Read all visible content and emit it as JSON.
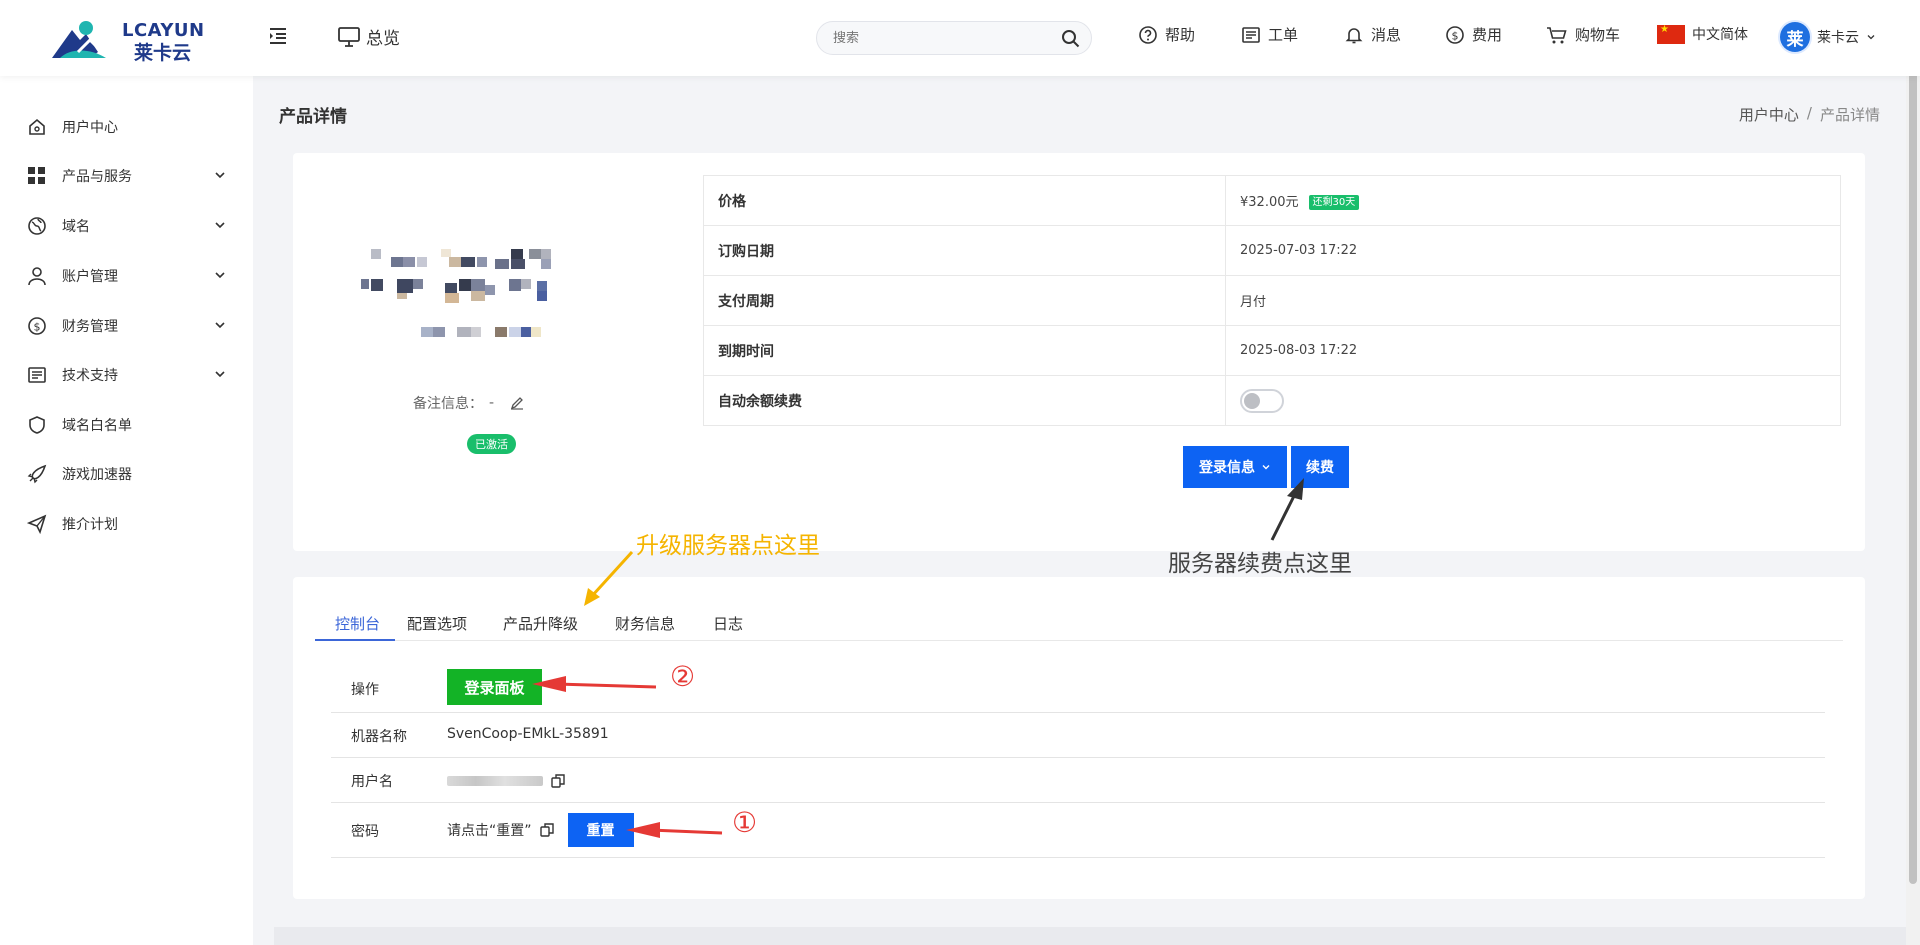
{
  "brand": {
    "logo_text_en": "LCAYUN",
    "logo_text_cn": "莱卡云"
  },
  "header": {
    "overview_label": "总览",
    "search_placeholder": "搜索",
    "help_label": "帮助",
    "ticket_label": "工单",
    "message_label": "消息",
    "fee_label": "费用",
    "cart_label": "购物车",
    "language_label": "中文简体",
    "avatar_char": "莱",
    "user_label": "莱卡云"
  },
  "sidebar": {
    "items": [
      {
        "label": "用户中心",
        "icon": "home-icon",
        "expandable": false
      },
      {
        "label": "产品与服务",
        "icon": "grid-icon",
        "expandable": true
      },
      {
        "label": "域名",
        "icon": "globe-icon",
        "expandable": true
      },
      {
        "label": "账户管理",
        "icon": "user-icon",
        "expandable": true
      },
      {
        "label": "财务管理",
        "icon": "dollar-icon",
        "expandable": true
      },
      {
        "label": "技术支持",
        "icon": "document-icon",
        "expandable": true
      },
      {
        "label": "域名白名单",
        "icon": "shield-icon",
        "expandable": false
      },
      {
        "label": "游戏加速器",
        "icon": "rocket-icon",
        "expandable": false
      },
      {
        "label": "推介计划",
        "icon": "send-icon",
        "expandable": false
      }
    ]
  },
  "page": {
    "title": "产品详情",
    "breadcrumb": {
      "parent": "用户中心",
      "separator": "/",
      "current": "产品详情"
    }
  },
  "product": {
    "remark_label": "备注信息：",
    "remark_value": "-",
    "status_badge": "已激活",
    "info": {
      "price_label": "价格",
      "price_value": "¥32.00元",
      "price_tag": "还剩30天",
      "order_date_label": "订购日期",
      "order_date_value": "2025-07-03 17:22",
      "pay_cycle_label": "支付周期",
      "pay_cycle_value": "月付",
      "expire_label": "到期时间",
      "expire_value": "2025-08-03 17:22",
      "auto_renew_label": "自动余额续费",
      "auto_renew_on": false
    },
    "login_info_button": "登录信息",
    "renew_button": "续费"
  },
  "annotations": {
    "upgrade_hint": "升级服务器点这里",
    "renew_hint": "服务器续费点这里",
    "step1": "①",
    "step2": "②",
    "colors": {
      "yellow": "#f5b400",
      "red": "#e53935",
      "gray": "#444444"
    }
  },
  "tabs": [
    {
      "label": "控制台",
      "active": true
    },
    {
      "label": "配置选项",
      "active": false
    },
    {
      "label": "产品升降级",
      "active": false
    },
    {
      "label": "财务信息",
      "active": false
    },
    {
      "label": "日志",
      "active": false
    }
  ],
  "console": {
    "operation_label": "操作",
    "login_panel_button": "登录面板",
    "machine_name_label": "机器名称",
    "machine_name_value": "SvenCoop-EMkL-35891",
    "username_label": "用户名",
    "password_label": "密码",
    "password_value": "请点击“重置”",
    "reset_button": "重置"
  },
  "colors": {
    "primary": "#0d63f3",
    "success": "#19be6b",
    "login_green": "#13b326",
    "tab_active": "#3b66d8"
  }
}
